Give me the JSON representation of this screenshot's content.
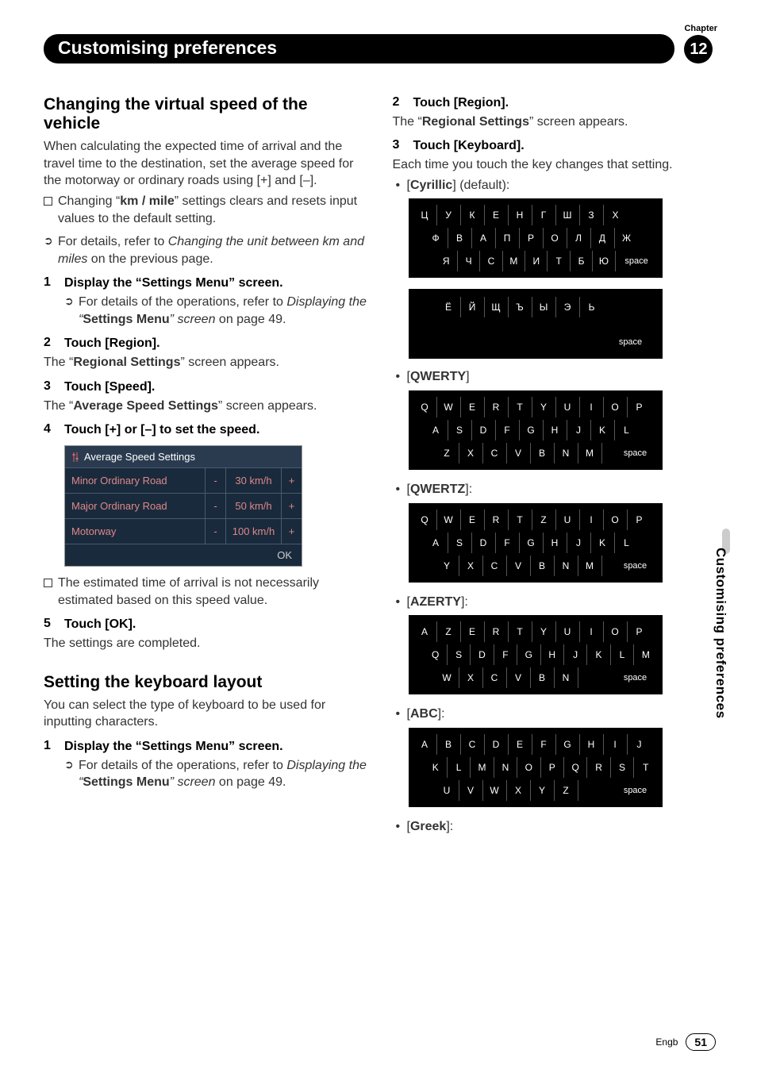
{
  "header": {
    "chapter_label": "Chapter",
    "title": "Customising preferences",
    "chapter_num": "12"
  },
  "side_tab": "Customising preferences",
  "footer": {
    "lang": "Engb",
    "page": "51"
  },
  "left": {
    "h_speed": "Changing the virtual speed of the vehicle",
    "p_intro": "When calculating the expected time of arrival and the travel time to the destination, set the average speed for the motorway or ordinary roads using [+] and [–].",
    "li_kmmile_a": "Changing “",
    "li_kmmile_bold": "km / mile",
    "li_kmmile_b": "” settings clears and resets input values to the default setting.",
    "li_details_a": "For details, refer to ",
    "li_details_i": "Changing the unit between km and miles",
    "li_details_b": " on the previous page.",
    "step1": "Display the “Settings Menu” screen.",
    "step1_sub_a": "For details of the operations, refer to ",
    "step1_sub_i1": "Displaying the “",
    "step1_sub_bold": "Settings Menu",
    "step1_sub_i2": "” screen",
    "step1_sub_b": " on page 49.",
    "step2": "Touch [Region].",
    "step2_body_a": "The “",
    "step2_body_bold": "Regional Settings",
    "step2_body_b": "” screen appears.",
    "step3": "Touch [Speed].",
    "step3_body_a": "The “",
    "step3_body_bold": "Average Speed Settings",
    "step3_body_b": "” screen appears.",
    "step4": "Touch [+] or [–] to set the speed.",
    "settings": {
      "title": "Average Speed Settings",
      "rows": [
        {
          "label": "Minor Ordinary Road",
          "val": "30 km/h"
        },
        {
          "label": "Major Ordinary Road",
          "val": "50 km/h"
        },
        {
          "label": "Motorway",
          "val": "100 km/h"
        }
      ],
      "minus": "-",
      "plus": "+",
      "ok": "OK"
    },
    "note_est": "The estimated time of arrival is not necessarily estimated based on this speed value.",
    "step5": "Touch [OK].",
    "step5_body": "The settings are completed.",
    "h_kbd": "Setting the keyboard layout",
    "p_kbd": "You can select the type of keyboard to be used for inputting characters.",
    "k_step1": "Display the “Settings Menu” screen.",
    "k_step1_sub_a": "For details of the operations, refer to ",
    "k_step1_sub_i1": "Displaying the “",
    "k_step1_sub_bold": "Settings Menu",
    "k_step1_sub_i2": "” screen",
    "k_step1_sub_b": " on page 49."
  },
  "right": {
    "step2": "Touch [Region].",
    "step2_body_a": "The “",
    "step2_body_bold": "Regional Settings",
    "step2_body_b": "” screen appears.",
    "step3": "Touch [Keyboard].",
    "step3_body": "Each time you touch the key changes that setting.",
    "cyr_a": "[",
    "cyr_bold": "Cyrillic",
    "cyr_b": "] (default):",
    "qwerty_a": "[",
    "qwerty_bold": "QWERTY",
    "qwerty_b": "]",
    "qwertz_a": "[",
    "qwertz_bold": "QWERTZ",
    "qwertz_b": "]:",
    "azerty_a": "[",
    "azerty_bold": "AZERTY",
    "azerty_b": "]:",
    "abc_a": "[",
    "abc_bold": "ABC",
    "abc_b": "]:",
    "greek_a": "[",
    "greek_bold": "Greek",
    "greek_b": "]:",
    "space": "space",
    "kbd_cyr1": [
      [
        "Ц",
        "У",
        "К",
        "Е",
        "Н",
        "Г",
        "Ш",
        "З",
        "Х"
      ],
      [
        "Ф",
        "В",
        "А",
        "П",
        "Р",
        "О",
        "Л",
        "Д",
        "Ж"
      ],
      [
        "Я",
        "Ч",
        "С",
        "М",
        "И",
        "Т",
        "Б",
        "Ю",
        "space"
      ]
    ],
    "kbd_cyr2": [
      [
        "Ё",
        "Й",
        "Щ",
        "Ъ",
        "Ы",
        "Э",
        "Ь"
      ]
    ],
    "kbd_qwerty": [
      [
        "Q",
        "W",
        "E",
        "R",
        "T",
        "Y",
        "U",
        "I",
        "O",
        "P"
      ],
      [
        "A",
        "S",
        "D",
        "F",
        "G",
        "H",
        "J",
        "K",
        "L"
      ],
      [
        "Z",
        "X",
        "C",
        "V",
        "B",
        "N",
        "M",
        "space"
      ]
    ],
    "kbd_qwertz": [
      [
        "Q",
        "W",
        "E",
        "R",
        "T",
        "Z",
        "U",
        "I",
        "O",
        "P"
      ],
      [
        "A",
        "S",
        "D",
        "F",
        "G",
        "H",
        "J",
        "K",
        "L"
      ],
      [
        "Y",
        "X",
        "C",
        "V",
        "B",
        "N",
        "M",
        "space"
      ]
    ],
    "kbd_azerty": [
      [
        "A",
        "Z",
        "E",
        "R",
        "T",
        "Y",
        "U",
        "I",
        "O",
        "P"
      ],
      [
        "Q",
        "S",
        "D",
        "F",
        "G",
        "H",
        "J",
        "K",
        "L",
        "M"
      ],
      [
        "W",
        "X",
        "C",
        "V",
        "B",
        "N",
        "space"
      ]
    ],
    "kbd_abc": [
      [
        "A",
        "B",
        "C",
        "D",
        "E",
        "F",
        "G",
        "H",
        "I",
        "J"
      ],
      [
        "K",
        "L",
        "M",
        "N",
        "O",
        "P",
        "Q",
        "R",
        "S",
        "T"
      ],
      [
        "U",
        "V",
        "W",
        "X",
        "Y",
        "Z",
        "space"
      ]
    ]
  }
}
